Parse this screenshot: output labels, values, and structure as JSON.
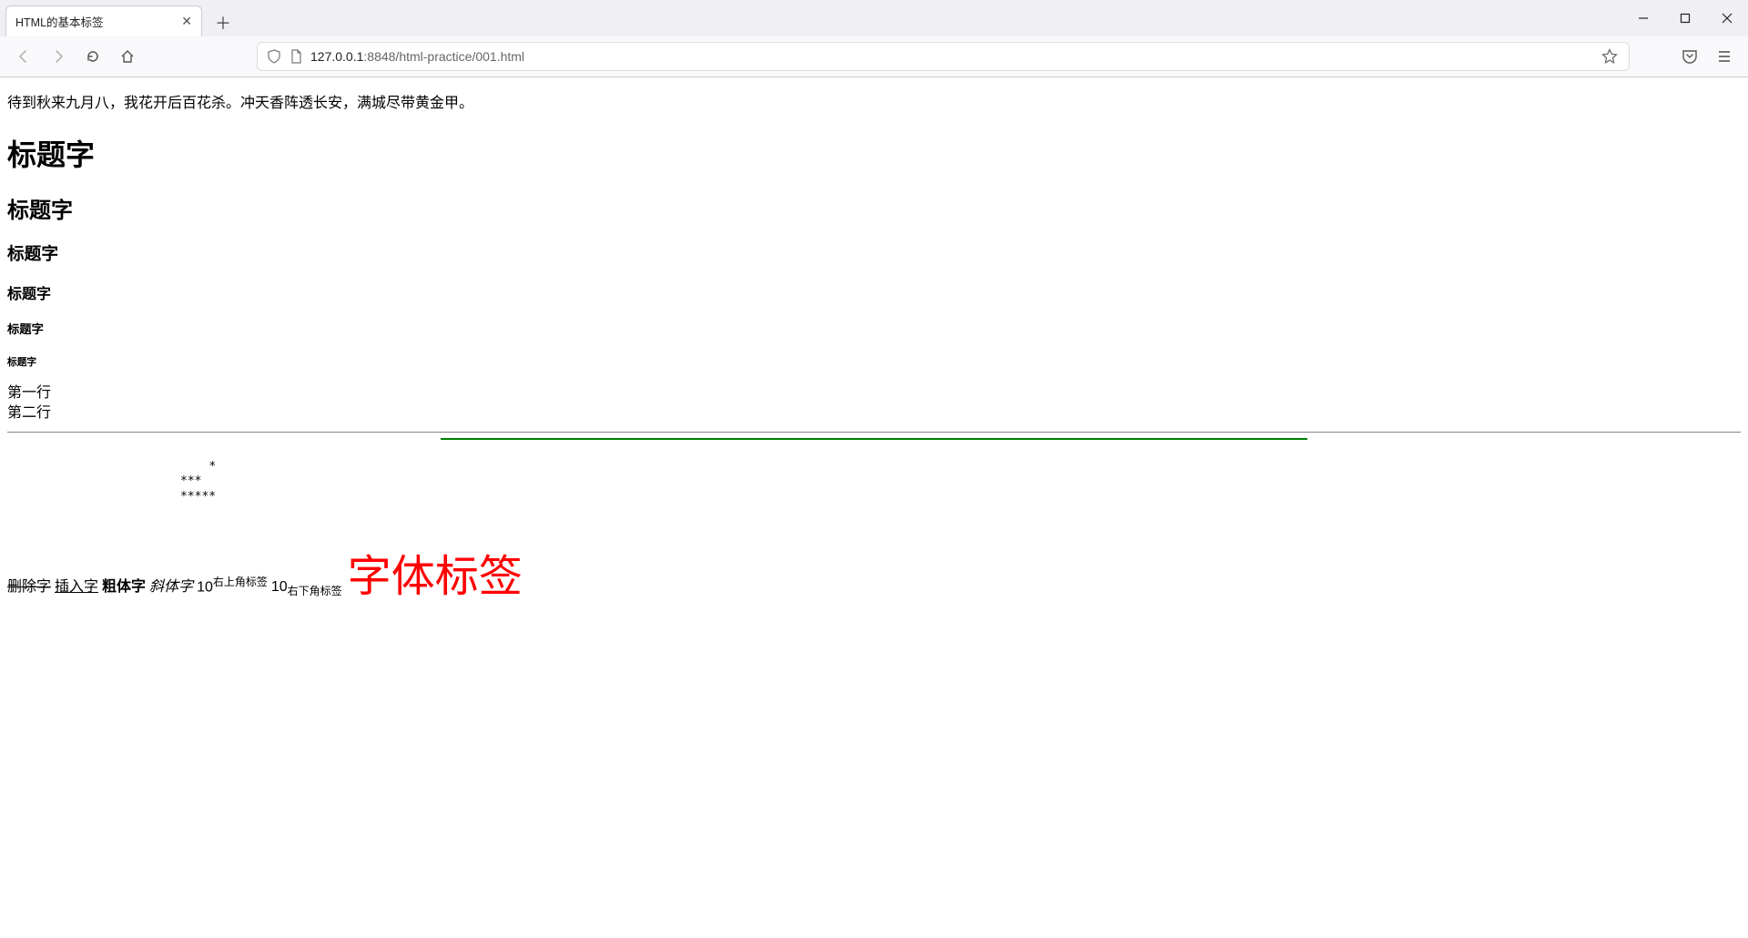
{
  "browser": {
    "tab_title": "HTML的基本标签",
    "url_display": "127.0.0.1:8848/html-practice/001.html",
    "url_host": "127.0.0.1",
    "url_rest": ":8848/html-practice/001.html"
  },
  "content": {
    "poem": "待到秋来九月八，我花开后百花杀。冲天香阵透长安，满城尽带黄金甲。",
    "h1": "标题字",
    "h2": "标题字",
    "h3": "标题字",
    "h4": "标题字",
    "h5": "标题字",
    "h6": "标题字",
    "line1": "第一行",
    "line2": "第二行",
    "center_stars": {
      "row1": "*",
      "row2": "***",
      "row3": "*****"
    },
    "pre_stars": "*\n***\n*****",
    "styled": {
      "del": "删除字",
      "ins": "插入字",
      "bold": "粗体字",
      "italic": "斜体字",
      "base1": "10",
      "sup": "右上角标签",
      "base2": "10",
      "sub": "右下角标签",
      "font_big": "字体标签"
    }
  },
  "hr2": {
    "color": "green",
    "width_percent": 50
  }
}
